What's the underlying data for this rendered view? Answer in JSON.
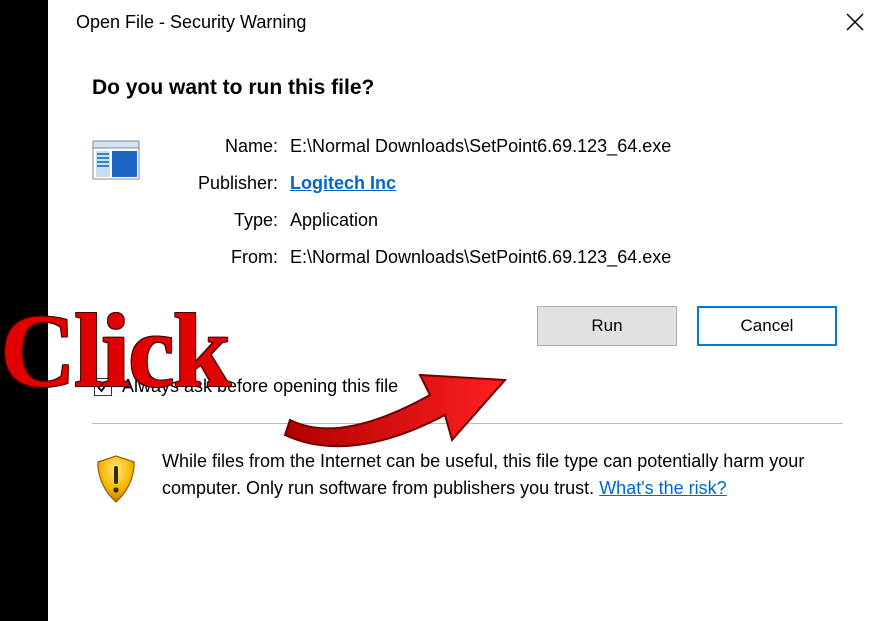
{
  "title": "Open File - Security Warning",
  "question": "Do you want to run this file?",
  "info": {
    "name_label": "Name:",
    "name_value": "E:\\Normal Downloads\\SetPoint6.69.123_64.exe",
    "publisher_label": "Publisher:",
    "publisher_value": "Logitech Inc",
    "type_label": "Type:",
    "type_value": "Application",
    "from_label": "From:",
    "from_value": "E:\\Normal Downloads\\SetPoint6.69.123_64.exe"
  },
  "buttons": {
    "run": "Run",
    "cancel": "Cancel"
  },
  "checkbox_label": "Always ask before opening this file",
  "warning_text": "While files from the Internet can be useful, this file type can potentially harm your computer. Only run software from publishers you trust. ",
  "risk_link": "What's the risk?",
  "annotation": "Click"
}
